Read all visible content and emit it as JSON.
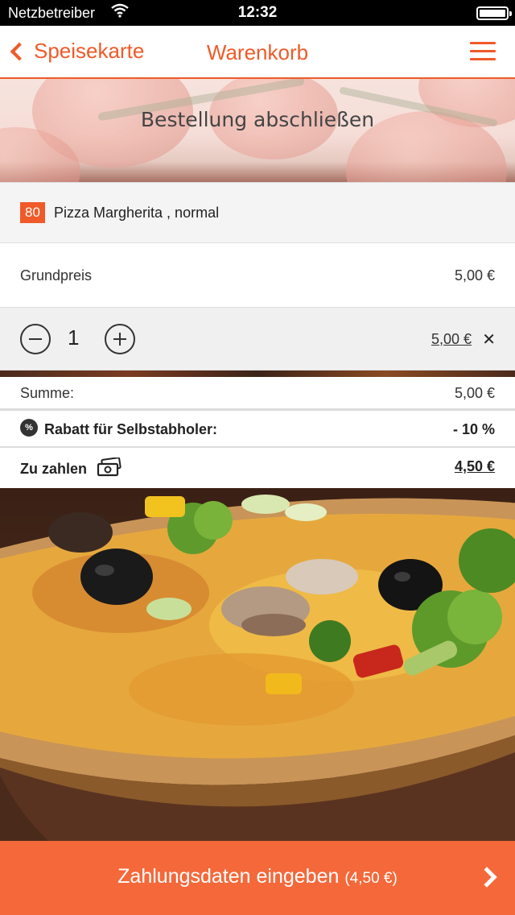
{
  "status_bar": {
    "carrier": "Netzbetreiber",
    "time": "12:32"
  },
  "nav": {
    "back_label": "Speisekarte",
    "title": "Warenkorb"
  },
  "hero": {
    "heading": "Bestellung abschließen"
  },
  "item": {
    "number": "80",
    "name": "Pizza Margherita , normal"
  },
  "base_price": {
    "label": "Grundpreis",
    "value": "5,00 €"
  },
  "quantity": {
    "value": "1",
    "line_total": "5,00 €",
    "remove_symbol": "✕"
  },
  "summary": {
    "sum_label": "Summe:",
    "sum_value": "5,00 €",
    "discount_icon_text": "%",
    "discount_label": "Rabatt für Selbstabholer:",
    "discount_value": "- 10 %",
    "total_label": "Zu zahlen",
    "total_value": "4,50 €"
  },
  "cta": {
    "label": "Zahlungsdaten eingeben",
    "amount": "(4,50 €)"
  },
  "colors": {
    "accent": "#f05a28",
    "cta_background": "#f4683a"
  }
}
